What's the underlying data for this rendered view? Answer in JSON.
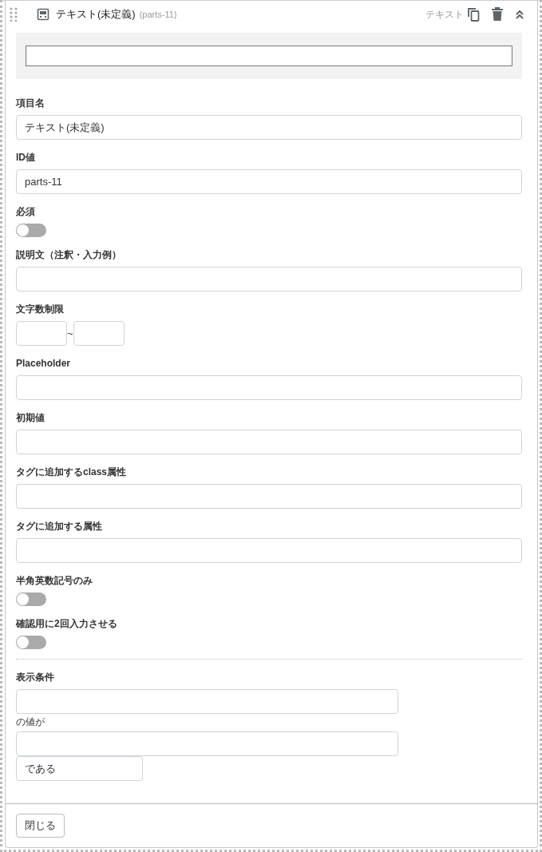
{
  "header": {
    "title": "テキスト(未定義)",
    "id_label": "(parts-11)",
    "type_label": "テキスト"
  },
  "fields": [
    {
      "kind": "text",
      "label": "項目名",
      "value": "テキスト(未定義)"
    },
    {
      "kind": "text",
      "label": "ID値",
      "value": "parts-11"
    },
    {
      "kind": "toggle",
      "label": "必須",
      "on": false
    },
    {
      "kind": "text",
      "label": "説明文（注釈・入力例）"
    },
    {
      "kind": "range",
      "label": "文字数制限",
      "separator": "~"
    },
    {
      "kind": "text",
      "label": "Placeholder"
    },
    {
      "kind": "text",
      "label": "初期値"
    },
    {
      "kind": "text",
      "label": "タグに追加するclass属性"
    },
    {
      "kind": "text",
      "label": "タグに追加する属性"
    },
    {
      "kind": "toggle",
      "label": "半角英数記号のみ",
      "on": false
    },
    {
      "kind": "toggle",
      "label": "確認用に2回入力させる",
      "on": false
    }
  ],
  "condition": {
    "label": "表示条件",
    "connector": "の値が",
    "operator": "である"
  },
  "close_button": "閉じる"
}
